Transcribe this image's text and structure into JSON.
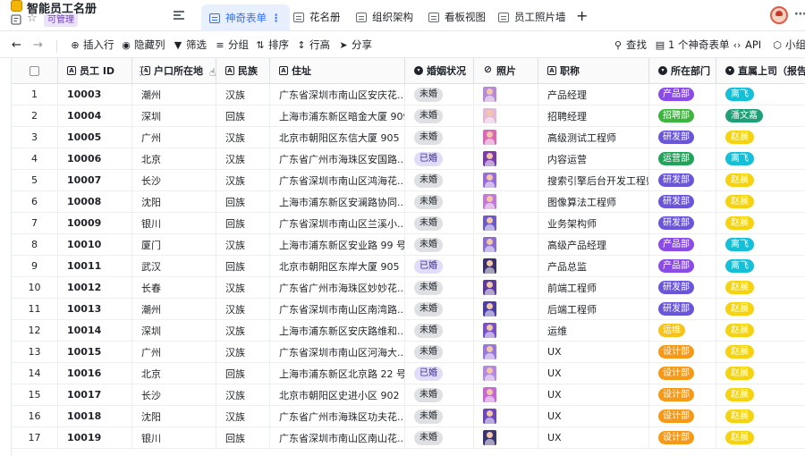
{
  "app": {
    "title": "智能员工名册",
    "permission_badge": "可管理"
  },
  "tabs": [
    {
      "label": "神奇表单",
      "active": true
    },
    {
      "label": "花名册"
    },
    {
      "label": "组织架构"
    },
    {
      "label": "看板视图"
    },
    {
      "label": "员工照片墙"
    }
  ],
  "toolbar": {
    "insert_row": "插入行",
    "hide_columns": "隐藏列",
    "filter": "筛选",
    "group": "分组",
    "sort": "排序",
    "row_height": "行高",
    "share": "分享",
    "find": "查找",
    "form_count": "1 个神奇表单",
    "api": "API",
    "widget": "小组"
  },
  "columns": [
    {
      "label": "员工 ID",
      "icon": "text-field-icon"
    },
    {
      "label": "户口所在地",
      "icon": "text-field-icon"
    },
    {
      "label": "民族",
      "icon": "text-field-icon"
    },
    {
      "label": "住址",
      "icon": "text-field-icon"
    },
    {
      "label": "婚姻状况",
      "icon": "single-select-icon"
    },
    {
      "label": "照片",
      "icon": "attachment-icon"
    },
    {
      "label": "职称",
      "icon": "text-field-icon"
    },
    {
      "label": "所在部门",
      "icon": "single-select-icon"
    },
    {
      "label": "直属上司（报告给",
      "icon": "single-select-icon"
    }
  ],
  "colors": {
    "accent": "#3370ff",
    "dept_product": "#8b4be6",
    "dept_recruit": "#3fb53f",
    "dept_rnd": "#6b55d8",
    "dept_ops": "#22a35a",
    "dept_design": "#f59a18",
    "boss_fei": "#14c0d8",
    "boss_wen": "#1f9f78",
    "boss_zhao": "#f5d40f"
  },
  "rows": [
    {
      "num": "1",
      "id": "10003",
      "hukou": "潮州",
      "ethnic": "汉族",
      "address": "广东省深圳市南山区安庆花...",
      "marital": "未婚",
      "photo_color": "#b78ad8",
      "title": "产品经理",
      "dept": "产品部",
      "dept_color": "#8b4be6",
      "boss": "离飞",
      "boss_color": "#14c0d8"
    },
    {
      "num": "2",
      "id": "10004",
      "hukou": "深圳",
      "ethnic": "回族",
      "address": "上海市浦东新区暗金大厦 909",
      "marital": "未婚",
      "photo_color": "#e5b8d6",
      "title": "招聘经理",
      "dept": "招聘部",
      "dept_color": "#3fb53f",
      "boss": "潘文嘉",
      "boss_color": "#1f9f78"
    },
    {
      "num": "3",
      "id": "10005",
      "hukou": "广州",
      "ethnic": "汉族",
      "address": "北京市朝阳区东信大厦 905",
      "marital": "未婚",
      "photo_color": "#d96ab8",
      "title": "高级测试工程师",
      "dept": "研发部",
      "dept_color": "#6b55d8",
      "boss": "赵晨",
      "boss_color": "#f5d40f"
    },
    {
      "num": "4",
      "id": "10006",
      "hukou": "北京",
      "ethnic": "汉族",
      "address": "广东省广州市海珠区安国路...",
      "marital": "已婚",
      "photo_color": "#7a3da8",
      "title": "内容运营",
      "dept": "运营部",
      "dept_color": "#22a35a",
      "boss": "离飞",
      "boss_color": "#14c0d8"
    },
    {
      "num": "5",
      "id": "10007",
      "hukou": "长沙",
      "ethnic": "汉族",
      "address": "广东省深圳市南山区鸿海花...",
      "marital": "未婚",
      "photo_color": "#9a6dd6",
      "title": "搜索引擎后台开发工程师",
      "dept": "研发部",
      "dept_color": "#6b55d8",
      "boss": "赵晨",
      "boss_color": "#f5d40f"
    },
    {
      "num": "6",
      "id": "10008",
      "hukou": "沈阳",
      "ethnic": "回族",
      "address": "上海市浦东新区安澜路协同...",
      "marital": "未婚",
      "photo_color": "#c27ad4",
      "title": "图像算法工程师",
      "dept": "研发部",
      "dept_color": "#6b55d8",
      "boss": "赵晨",
      "boss_color": "#f5d40f"
    },
    {
      "num": "7",
      "id": "10009",
      "hukou": "银川",
      "ethnic": "回族",
      "address": "广东省深圳市南山区兰溪小...",
      "marital": "未婚",
      "photo_color": "#6d5bc4",
      "title": "业务架构师",
      "dept": "研发部",
      "dept_color": "#6b55d8",
      "boss": "赵晨",
      "boss_color": "#f5d40f"
    },
    {
      "num": "8",
      "id": "10010",
      "hukou": "厦门",
      "ethnic": "汉族",
      "address": "上海市浦东新区安业路 99 号",
      "marital": "未婚",
      "photo_color": "#8a6fd0",
      "title": "高级产品经理",
      "dept": "产品部",
      "dept_color": "#8b4be6",
      "boss": "离飞",
      "boss_color": "#14c0d8"
    },
    {
      "num": "9",
      "id": "10011",
      "hukou": "武汉",
      "ethnic": "回族",
      "address": "北京市朝阳区东岸大厦 905",
      "marital": "已婚",
      "photo_color": "#3b2f6e",
      "title": "产品总监",
      "dept": "产品部",
      "dept_color": "#8b4be6",
      "boss": "离飞",
      "boss_color": "#14c0d8"
    },
    {
      "num": "10",
      "id": "10012",
      "hukou": "长春",
      "ethnic": "汉族",
      "address": "广东省广州市海珠区妙妙花...",
      "marital": "未婚",
      "photo_color": "#5a3a9a",
      "title": "前端工程师",
      "dept": "研发部",
      "dept_color": "#6b55d8",
      "boss": "赵晨",
      "boss_color": "#f5d40f"
    },
    {
      "num": "11",
      "id": "10013",
      "hukou": "潮州",
      "ethnic": "汉族",
      "address": "广东省深圳市南山区南湾路...",
      "marital": "未婚",
      "photo_color": "#4b3ea0",
      "title": "后端工程师",
      "dept": "研发部",
      "dept_color": "#6b55d8",
      "boss": "赵晨",
      "boss_color": "#f5d40f"
    },
    {
      "num": "12",
      "id": "10014",
      "hukou": "深圳",
      "ethnic": "汉族",
      "address": "上海市浦东新区安庆路维和...",
      "marital": "未婚",
      "photo_color": "#7a52c8",
      "title": "运维",
      "dept": "运维",
      "dept_color": "#f5c31a",
      "boss": "赵晨",
      "boss_color": "#f5d40f"
    },
    {
      "num": "13",
      "id": "10015",
      "hukou": "广州",
      "ethnic": "汉族",
      "address": "广东省深圳市南山区河海大...",
      "marital": "未婚",
      "photo_color": "#9a7ad8",
      "title": "UX",
      "dept": "设计部",
      "dept_color": "#f59a18",
      "boss": "赵晨",
      "boss_color": "#f5d40f"
    },
    {
      "num": "14",
      "id": "10016",
      "hukou": "北京",
      "ethnic": "回族",
      "address": "上海市浦东新区北京路 22 号",
      "marital": "已婚",
      "photo_color": "#b48ae0",
      "title": "UX",
      "dept": "设计部",
      "dept_color": "#f59a18",
      "boss": "赵晨",
      "boss_color": "#f5d40f"
    },
    {
      "num": "15",
      "id": "10017",
      "hukou": "长沙",
      "ethnic": "汉族",
      "address": "北京市朝阳区史进小区 902",
      "marital": "未婚",
      "photo_color": "#c46ad0",
      "title": "UX",
      "dept": "设计部",
      "dept_color": "#f59a18",
      "boss": "赵晨",
      "boss_color": "#f5d40f"
    },
    {
      "num": "16",
      "id": "10018",
      "hukou": "沈阳",
      "ethnic": "汉族",
      "address": "广东省广州市海珠区功夫花...",
      "marital": "未婚",
      "photo_color": "#6e48b8",
      "title": "UX",
      "dept": "设计部",
      "dept_color": "#f59a18",
      "boss": "赵晨",
      "boss_color": "#f5d40f"
    },
    {
      "num": "17",
      "id": "10019",
      "hukou": "银川",
      "ethnic": "回族",
      "address": "广东省深圳市南山区南山花...",
      "marital": "未婚",
      "photo_color": "#3a3470",
      "title": "UX",
      "dept": "设计部",
      "dept_color": "#f59a18",
      "boss": "赵晨",
      "boss_color": "#f5d40f"
    }
  ]
}
